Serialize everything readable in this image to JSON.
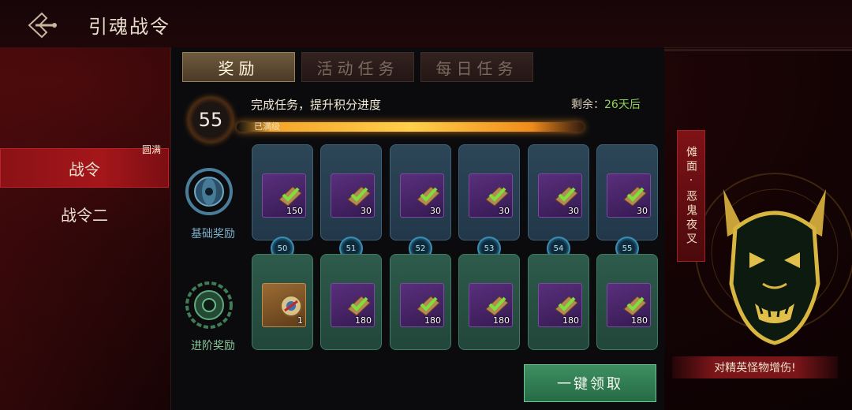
{
  "header": {
    "title": "引魂战令"
  },
  "sidebar": {
    "items": [
      {
        "label": "战令",
        "active": true,
        "badge": "圆满"
      },
      {
        "label": "战令二",
        "active": false
      }
    ]
  },
  "tabs": [
    {
      "label": "奖励",
      "active": true
    },
    {
      "label": "活动任务",
      "active": false
    },
    {
      "label": "每日任务",
      "active": false
    }
  ],
  "progress": {
    "level": "55",
    "task_text": "完成任务，提升积分进度",
    "remain_label": "剩余：",
    "remain_days": "26天后",
    "status": "已满级",
    "fill": 1.0
  },
  "rows": {
    "basic_label": "基础奖励",
    "advanced_label": "进阶奖励"
  },
  "levels": [
    "50",
    "51",
    "52",
    "53",
    "54",
    "55"
  ],
  "basic_rewards": [
    {
      "qty": "150",
      "icon": "scroll-icon",
      "claimed": true
    },
    {
      "qty": "30",
      "icon": "scroll-icon",
      "claimed": true
    },
    {
      "qty": "30",
      "icon": "scroll-icon",
      "claimed": true
    },
    {
      "qty": "30",
      "icon": "scroll-icon",
      "claimed": true
    },
    {
      "qty": "30",
      "icon": "scroll-icon",
      "claimed": true
    },
    {
      "qty": "30",
      "icon": "scroll-icon",
      "claimed": true
    }
  ],
  "advanced_rewards": [
    {
      "qty": "1",
      "icon": "medallion-icon",
      "claimed": true
    },
    {
      "qty": "180",
      "icon": "scroll-icon",
      "claimed": true
    },
    {
      "qty": "180",
      "icon": "scroll-icon",
      "claimed": true
    },
    {
      "qty": "180",
      "icon": "scroll-icon",
      "claimed": true
    },
    {
      "qty": "180",
      "icon": "scroll-icon",
      "claimed": true
    },
    {
      "qty": "180",
      "icon": "scroll-icon",
      "claimed": true
    }
  ],
  "claim_button": "一键领取",
  "showcase": {
    "name": "傩面·恶鬼夜叉",
    "buff": "对精英怪物增伤!"
  },
  "colors": {
    "accent_red": "#a5161a",
    "claim_green": "#3e8f62",
    "remain_green": "#8fd15a",
    "progress_gold": "#ffcf4a"
  }
}
